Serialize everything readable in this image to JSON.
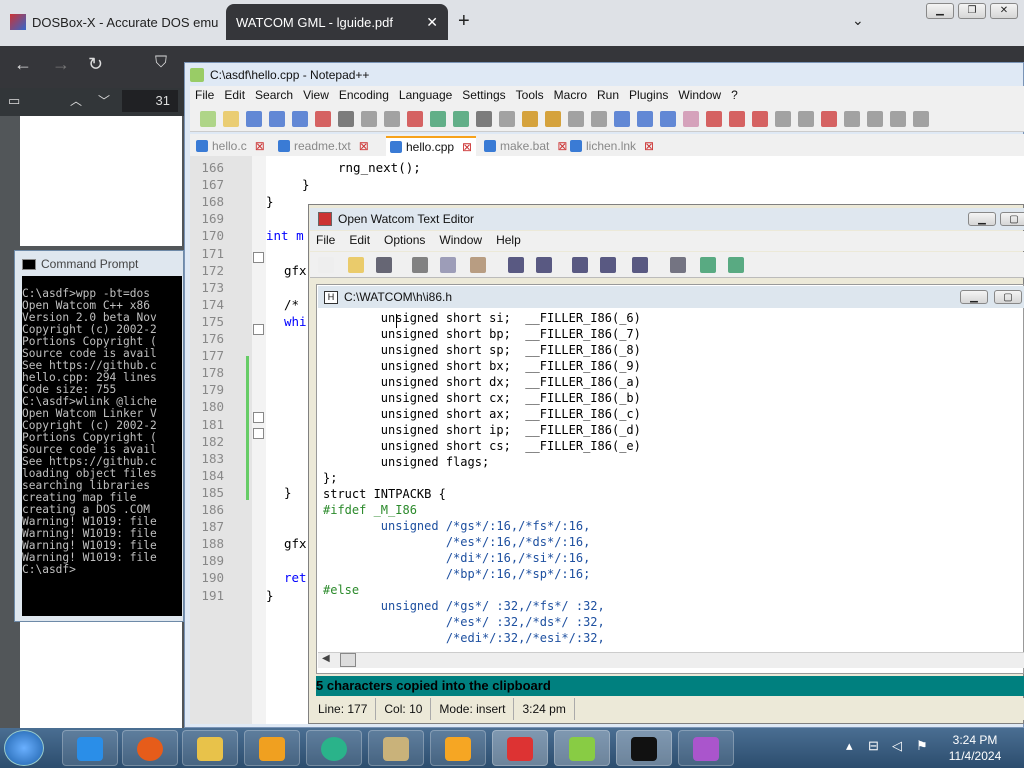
{
  "browser": {
    "tabs": [
      {
        "label": "DOSBox-X - Accurate DOS emu"
      },
      {
        "label": "WATCOM GML - lguide.pdf"
      }
    ],
    "new_tab": "+",
    "page_number": "31"
  },
  "cmd": {
    "title": "Command Prompt",
    "lines": [
      "C:\\asdf>wpp -bt=dos",
      "Open Watcom C++ x86",
      "Version 2.0 beta Nov",
      "Copyright (c) 2002-2",
      "Portions Copyright (",
      "Source code is avail",
      "See https://github.c",
      "hello.cpp: 294 lines",
      "Code size: 755",
      "",
      "C:\\asdf>wlink @liche",
      "Open Watcom Linker V",
      "Copyright (c) 2002-2",
      "Portions Copyright (",
      "Source code is avail",
      "See https://github.c",
      "loading object files",
      "searching libraries",
      "creating map file",
      "creating a DOS .COM",
      "Warning! W1019: file",
      "Warning! W1019: file",
      "Warning! W1019: file",
      "Warning! W1019: file",
      "",
      "C:\\asdf>"
    ]
  },
  "npp": {
    "title": "C:\\asdf\\hello.cpp - Notepad++",
    "menu": [
      "File",
      "Edit",
      "Search",
      "View",
      "Encoding",
      "Language",
      "Settings",
      "Tools",
      "Macro",
      "Run",
      "Plugins",
      "Window",
      "?"
    ],
    "tabs": [
      "hello.c",
      "readme.txt",
      "hello.cpp",
      "make.bat",
      "lichen.lnk"
    ],
    "active_tab": "hello.cpp",
    "line_numbers": [
      "166",
      "167",
      "168",
      "169",
      "170",
      "171",
      "172",
      "173",
      "174",
      "175",
      "176",
      "177",
      "178",
      "179",
      "180",
      "181",
      "182",
      "183",
      "184",
      "185",
      "186",
      "187",
      "188",
      "189",
      "190",
      "191"
    ],
    "code": {
      "l166": "rng_next();",
      "l167": "}",
      "l168": "}",
      "l170": "int m",
      "l172": "gfx",
      "l174": "/*",
      "l175": "whi",
      "l185": "}",
      "l188": "gfx",
      "l190": "ret",
      "l191": "}"
    }
  },
  "watcom": {
    "title": "Open Watcom Text Editor",
    "menu": [
      "File",
      "Edit",
      "Options",
      "Window",
      "Help"
    ],
    "doc_title": "C:\\WATCOM\\h\\i86.h",
    "lines": [
      "        unsigned short si;  __FILLER_I86(_6)",
      "        unsigned short bp;  __FILLER_I86(_7)",
      "        unsigned short sp;  __FILLER_I86(_8)",
      "        unsigned short bx;  __FILLER_I86(_9)",
      "        unsigned short dx;  __FILLER_I86(_a)",
      "        unsigned short cx;  __FILLER_I86(_b)",
      "        unsigned short ax;  __FILLER_I86(_c)",
      "        unsigned short ip;  __FILLER_I86(_d)",
      "        unsigned short cs;  __FILLER_I86(_e)",
      "        unsigned flags;",
      "};",
      "struct INTPACKB {",
      "#ifdef _M_I86",
      "        unsigned /*gs*/:16,/*fs*/:16,",
      "                 /*es*/:16,/*ds*/:16,",
      "                 /*di*/:16,/*si*/:16,",
      "                 /*bp*/:16,/*sp*/:16;",
      "#else",
      "        unsigned /*gs*/ :32,/*fs*/ :32,",
      "                 /*es*/ :32,/*ds*/ :32,",
      "                 /*edi*/:32,/*esi*/:32,"
    ],
    "message": "5 characters copied into the clipboard",
    "status": {
      "line": "Line: 177",
      "col": "Col: 10",
      "mode": "Mode: insert",
      "time": "3:24 pm"
    }
  },
  "taskbar": {
    "time": "3:24 PM",
    "date": "11/4/2024"
  },
  "colors": {
    "watcom_message_bg": "#00807f",
    "npp_active_tab_accent": "#f7a21b",
    "cmd_bg": "#000000"
  }
}
